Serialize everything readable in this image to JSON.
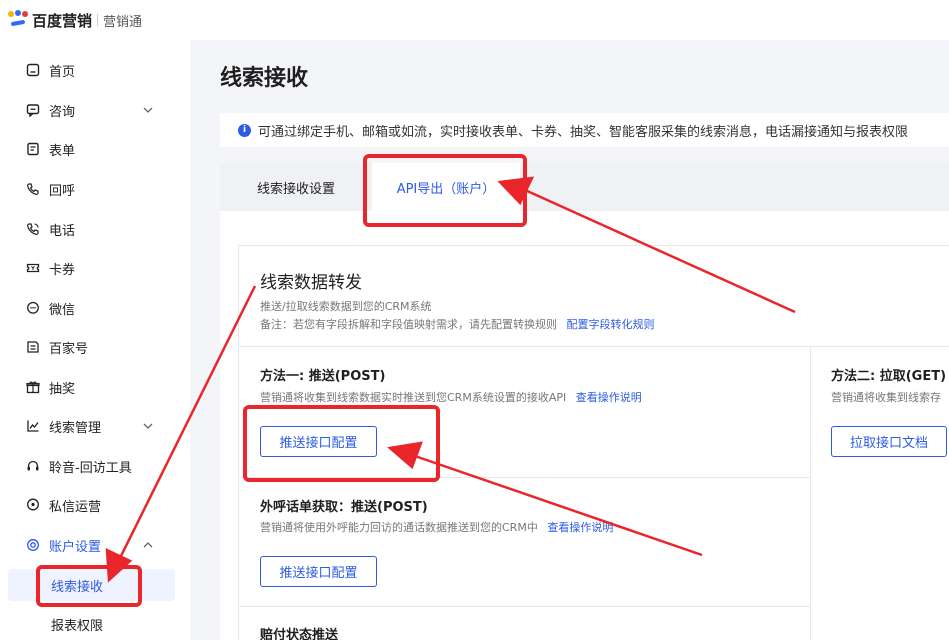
{
  "header": {
    "brand": "百度营销",
    "product": "营销通"
  },
  "sidebar": {
    "items": [
      {
        "label": "首页",
        "icon": "home-icon"
      },
      {
        "label": "咨询",
        "icon": "chat-icon"
      },
      {
        "label": "表单",
        "icon": "form-icon"
      },
      {
        "label": "回呼",
        "icon": "callback-icon"
      },
      {
        "label": "电话",
        "icon": "phone-icon"
      },
      {
        "label": "卡券",
        "icon": "coupon-icon"
      },
      {
        "label": "微信",
        "icon": "wechat-icon"
      },
      {
        "label": "百家号",
        "icon": "baijiahao-icon"
      },
      {
        "label": "抽奖",
        "icon": "lottery-icon"
      },
      {
        "label": "线索管理",
        "icon": "chart-icon"
      },
      {
        "label": "聆音-回访工具",
        "icon": "headset-icon"
      },
      {
        "label": "私信运营",
        "icon": "message-icon"
      },
      {
        "label": "账户设置",
        "icon": "settings-icon"
      }
    ],
    "sub_items": [
      {
        "label": "线索接收"
      },
      {
        "label": "报表权限"
      }
    ]
  },
  "main": {
    "title": "线索接收",
    "notice": "可通过绑定手机、邮箱或如流，实时接收表单、卡券、抽奖、智能客服采集的线索消息，电话漏接通知与报表权限",
    "tabs": [
      {
        "label": "线索接收设置"
      },
      {
        "label": "API导出（账户）"
      }
    ],
    "panel": {
      "title": "线索数据转发",
      "desc": "推送/拉取线索数据到您的CRM系统",
      "note": "备注：若您有字段拆解和字段值映射需求，请先配置转换规则",
      "note_link": "配置字段转化规则",
      "method_push": {
        "title": "方法一: 推送(POST)",
        "desc": "营销通将收集到线索数据实时推送到您CRM系统设置的接收API",
        "link": "查看操作说明",
        "button": "推送接口配置"
      },
      "method_pull": {
        "title": "方法二: 拉取(GET)",
        "desc": "营销通将收集到线索存",
        "button": "拉取接口文档"
      },
      "outbound": {
        "title": "外呼话单获取：推送(POST)",
        "desc": "营销通将使用外呼能力回访的通话数据推送到您的CRM中",
        "link": "查看操作说明",
        "button": "推送接口配置"
      },
      "payment": {
        "title": "赔付状态推送"
      }
    }
  },
  "colors": {
    "accent": "#2d5be3",
    "annotation": "#e8262b"
  }
}
